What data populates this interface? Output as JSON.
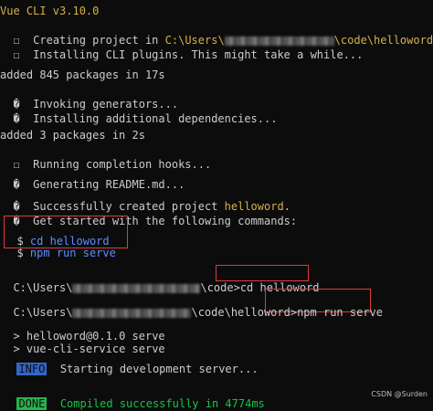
{
  "lines": {
    "l1": "Vue CLI v3.10.0",
    "l2": {
      "text": "Creating project in ",
      "path_start": "C:\\Users\\",
      "path_end": "\\code\\helloword."
    },
    "l3": "Installing CLI plugins. This might take a while...",
    "l4": "added 845 packages in 17s",
    "l5": "Invoking generators...",
    "l6": "Installing additional dependencies...",
    "l7": "added 3 packages in 2s",
    "l8": "Running completion hooks...",
    "l9": "Generating README.md...",
    "l10": {
      "text": "Successfully created project ",
      "project": "helloword",
      "end": "."
    },
    "l11": "Get started with the following commands:",
    "cmd1": "cd helloword",
    "cmd2": "npm run serve",
    "p1": {
      "prefix": "C:\\Users\\",
      "mid": "\\code",
      "cmd": ">cd helloword"
    },
    "p2": {
      "prefix": "C:\\Users\\",
      "mid": "\\code\\helloword",
      "cmd": ">npm run serve"
    },
    "s1": "helloword@0.1.0 serve",
    "s2": "vue-cli-service serve",
    "info_badge": "INFO",
    "info_text": "Starting development server...",
    "done_badge": "DONE",
    "done_text": "Compiled successfully in 4774ms"
  },
  "glyphs": {
    "box": "☐",
    "diamond": "�",
    "dollar": "$",
    "arrow": ">"
  },
  "watermark": "CSDN @Surden"
}
